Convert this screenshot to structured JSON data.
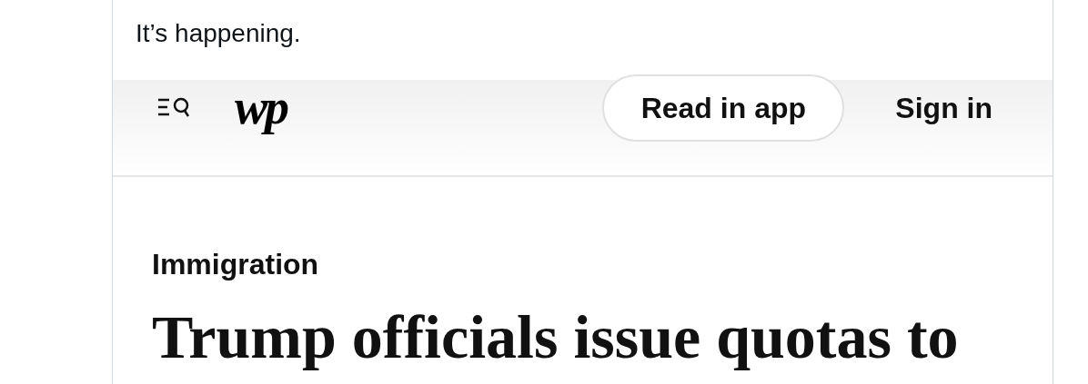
{
  "post": {
    "text": "It’s happening."
  },
  "site_header": {
    "logo": "wp",
    "buttons": [
      "Read in app",
      "Sign in"
    ]
  },
  "article": {
    "section": "Immigration",
    "headline": "Trump officials issue quotas to"
  }
}
